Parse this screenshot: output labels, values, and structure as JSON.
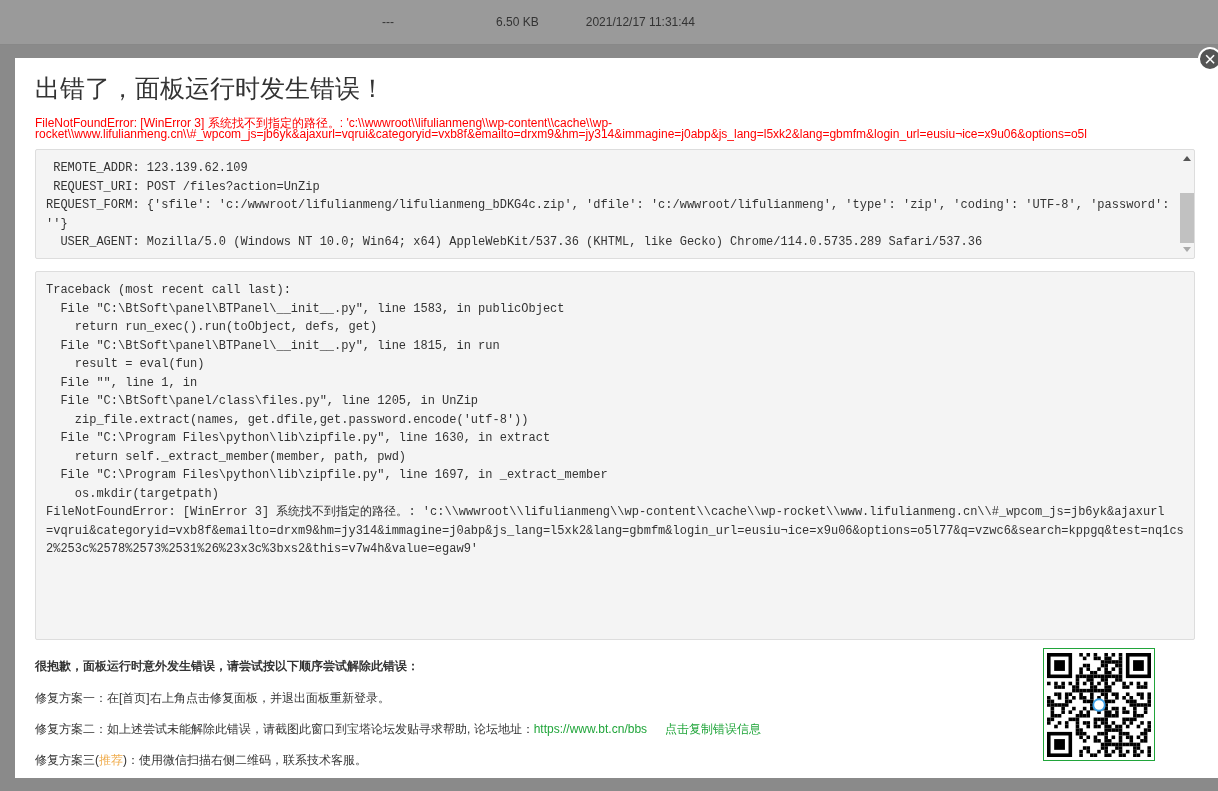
{
  "background_row": {
    "column_1": "---",
    "column_2": "6.50 KB",
    "column_3": "2021/12/17 11:31:44"
  },
  "dialog": {
    "close_icon": "×",
    "title": "出错了，面板运行时发生错误！",
    "error_summary_lines": [
      "FileNotFoundError: [WinError 3] 系统找不到指定的路径。: 'c:\\\\wwwroot\\\\lifulianmeng\\\\wp-content\\\\cache\\\\wp-",
      "rocket\\\\www.lifulianmeng.cn\\\\#_wpcom_js=jb6yk&ajaxurl=vqrui&categoryid=vxb8f&emailto=drxm9&hm=jy314&immagine=j0abp&js_lang=l5xk2&lang=gbmfm&login_url=eusiu¬ice=x9u06&options=o5l"
    ],
    "request_info_lines": [
      " REMOTE_ADDR: 123.139.62.109",
      " REQUEST_URI: POST /files?action=UnZip",
      "REQUEST_FORM: {'sfile': 'c:/wwwroot/lifulianmeng/lifulianmeng_bDKG4c.zip', 'dfile': 'c:/wwwroot/lifulianmeng', 'type': 'zip', 'coding': 'UTF-8', 'password':",
      "''}",
      "  USER_AGENT: Mozilla/5.0 (Windows NT 10.0; Win64; x64) AppleWebKit/537.36 (KHTML, like Gecko) Chrome/114.0.5735.289 Safari/537.36"
    ],
    "traceback_lines": [
      "Traceback (most recent call last):",
      "  File \"C:\\BtSoft\\panel\\BTPanel\\__init__.py\", line 1583, in publicObject",
      "    return run_exec().run(toObject, defs, get)",
      "  File \"C:\\BtSoft\\panel\\BTPanel\\__init__.py\", line 1815, in run",
      "    result = eval(fun)",
      "  File \"\", line 1, in",
      "  File \"C:\\BtSoft\\panel/class\\files.py\", line 1205, in UnZip",
      "    zip_file.extract(names, get.dfile,get.password.encode('utf-8'))",
      "  File \"C:\\Program Files\\python\\lib\\zipfile.py\", line 1630, in extract",
      "    return self._extract_member(member, path, pwd)",
      "  File \"C:\\Program Files\\python\\lib\\zipfile.py\", line 1697, in _extract_member",
      "    os.mkdir(targetpath)",
      "FileNotFoundError: [WinError 3] 系统找不到指定的路径。: 'c:\\\\wwwroot\\\\lifulianmeng\\\\wp-content\\\\cache\\\\wp-rocket\\\\www.lifulianmeng.cn\\\\#_wpcom_js=jb6yk&ajaxurl",
      "=vqrui&categoryid=vxb8f&emailto=drxm9&hm=jy314&immagine=j0abp&js_lang=l5xk2&lang=gbmfm&login_url=eusiu¬ice=x9u06&options=o5l77&q=vzwc6&search=kppgq&test=nq1cs",
      "2%253c%2578%2573%2531%26%23x3c%3bxs2&this=v7w4h&value=egaw9'"
    ],
    "help_heading": "很抱歉，面板运行时意外发生错误，请尝试按以下顺序尝试解除此错误：",
    "solution_1": "修复方案一：在[首页]右上角点击修复面板，并退出面板重新登录。",
    "solution_2": {
      "text": "修复方案二：如上述尝试未能解除此错误，请截图此窗口到宝塔论坛发贴寻求帮助, 论坛地址：",
      "forum_link": "https://www.bt.cn/bbs",
      "copy_link": "点击复制错误信息"
    },
    "solution_3": {
      "prefix": "修复方案三(",
      "highlight": "推荐",
      "suffix": ")：使用微信扫描右侧二维码，联系技术客服。"
    }
  }
}
